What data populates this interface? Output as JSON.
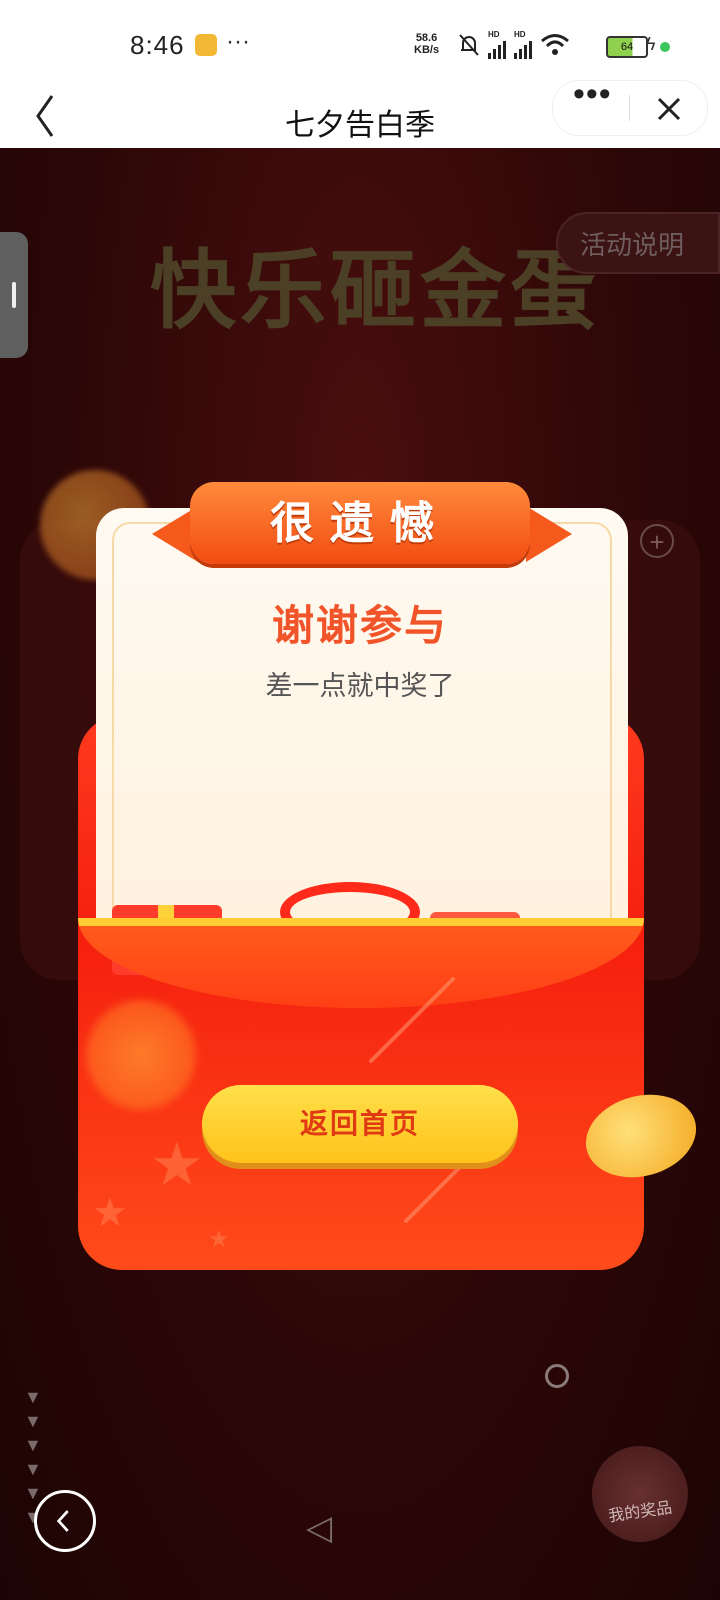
{
  "status_bar": {
    "time": "8:46",
    "more": "···",
    "net_speed_value": "58.6",
    "net_speed_unit": "KB/s",
    "hd1": "HD",
    "hd2": "HD",
    "battery": "64"
  },
  "nav": {
    "title": "七夕告白季",
    "more": "•••"
  },
  "background": {
    "title": "快乐砸金蛋",
    "rules_button": "活动说明",
    "my_prize": "我的奖品"
  },
  "popup": {
    "ribbon": "很遗憾",
    "title": "谢谢参与",
    "subtitle": "差一点就中奖了",
    "button": "返回首页"
  },
  "colors": {
    "accent": "#f2542a",
    "button": "#ffd23a",
    "envelope": "#ff3a1e"
  }
}
